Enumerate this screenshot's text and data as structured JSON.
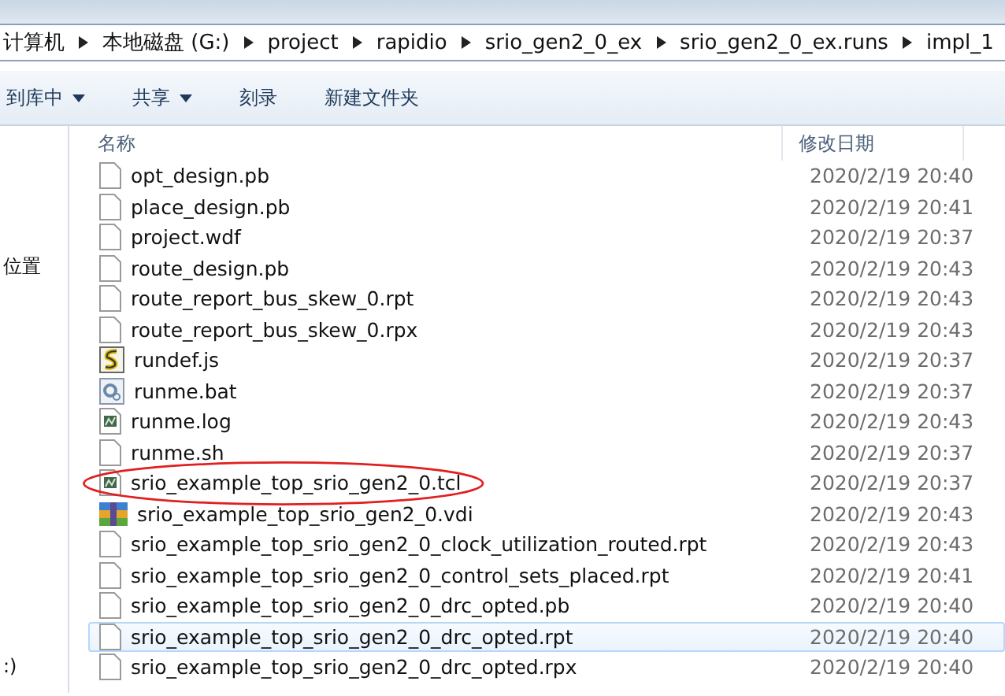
{
  "breadcrumb": [
    "计算机",
    "本地磁盘 (G:)",
    "project",
    "rapidio",
    "srio_gen2_0_ex",
    "srio_gen2_0_ex.runs",
    "impl_1"
  ],
  "toolbar": [
    {
      "label": "到库中",
      "dropdown": true
    },
    {
      "label": "共享",
      "dropdown": true
    },
    {
      "label": "刻录",
      "dropdown": false
    },
    {
      "label": "新建文件夹",
      "dropdown": false
    }
  ],
  "nav_pane": {
    "items": [
      "位置",
      ":)"
    ]
  },
  "columns": [
    "名称",
    "修改日期"
  ],
  "files": [
    {
      "name": "opt_design.pb",
      "modified": "2020/2/19 20:40",
      "kind": "blank",
      "selected": false,
      "circled": false
    },
    {
      "name": "place_design.pb",
      "modified": "2020/2/19 20:41",
      "kind": "blank",
      "selected": false,
      "circled": false
    },
    {
      "name": "project.wdf",
      "modified": "2020/2/19 20:37",
      "kind": "blank",
      "selected": false,
      "circled": false
    },
    {
      "name": "route_design.pb",
      "modified": "2020/2/19 20:43",
      "kind": "blank",
      "selected": false,
      "circled": false
    },
    {
      "name": "route_report_bus_skew_0.rpt",
      "modified": "2020/2/19 20:43",
      "kind": "blank",
      "selected": false,
      "circled": false
    },
    {
      "name": "route_report_bus_skew_0.rpx",
      "modified": "2020/2/19 20:43",
      "kind": "blank",
      "selected": false,
      "circled": false
    },
    {
      "name": "rundef.js",
      "modified": "2020/2/19 20:37",
      "kind": "script",
      "selected": false,
      "circled": false
    },
    {
      "name": "runme.bat",
      "modified": "2020/2/19 20:37",
      "kind": "batch",
      "selected": false,
      "circled": false
    },
    {
      "name": "runme.log",
      "modified": "2020/2/19 20:43",
      "kind": "log",
      "selected": false,
      "circled": false
    },
    {
      "name": "runme.sh",
      "modified": "2020/2/19 20:37",
      "kind": "blank",
      "selected": false,
      "circled": false
    },
    {
      "name": "srio_example_top_srio_gen2_0.tcl",
      "modified": "2020/2/19 20:37",
      "kind": "log",
      "selected": false,
      "circled": true
    },
    {
      "name": "srio_example_top_srio_gen2_0.vdi",
      "modified": "2020/2/19 20:43",
      "kind": "archive",
      "selected": false,
      "circled": false
    },
    {
      "name": "srio_example_top_srio_gen2_0_clock_utilization_routed.rpt",
      "modified": "2020/2/19 20:43",
      "kind": "blank",
      "selected": false,
      "circled": false
    },
    {
      "name": "srio_example_top_srio_gen2_0_control_sets_placed.rpt",
      "modified": "2020/2/19 20:41",
      "kind": "blank",
      "selected": false,
      "circled": false
    },
    {
      "name": "srio_example_top_srio_gen2_0_drc_opted.pb",
      "modified": "2020/2/19 20:40",
      "kind": "blank",
      "selected": false,
      "circled": false
    },
    {
      "name": "srio_example_top_srio_gen2_0_drc_opted.rpt",
      "modified": "2020/2/19 20:40",
      "kind": "blank",
      "selected": true,
      "circled": false
    },
    {
      "name": "srio_example_top_srio_gen2_0_drc_opted.rpx",
      "modified": "2020/2/19 20:40",
      "kind": "blank",
      "selected": false,
      "circled": false
    }
  ]
}
